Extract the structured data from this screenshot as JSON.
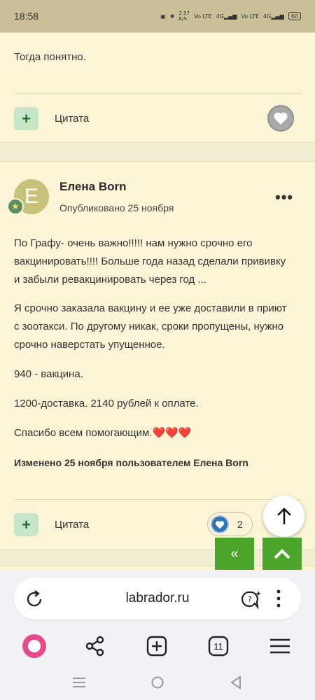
{
  "status": {
    "time": "18:58",
    "speed": "2,97",
    "speed_unit": "K/S",
    "sim1": "Vo LTE",
    "net1": "4G",
    "sim2": "Vo LTE",
    "net2": "4G",
    "battery": "60"
  },
  "post1": {
    "text": "Тогда понятно.",
    "quote_label": "Цитата"
  },
  "post2": {
    "avatar_letter": "E",
    "author": "Елена Born",
    "published": "Опубликовано 25 ноября",
    "paragraphs": [
      "По Графу-  очень важно!!!!! нам нужно срочно его вакцинировать!!!! Больше года назад сделали прививку и забыли ревакцинировать через год ...",
      "Я срочно заказала вакцину и ее уже доставили в приют с зоотакси. По другому никак, сроки пропущены, нужно срочно наверстать упущенное.",
      "940 - вакцина.",
      "1200-доставка. 2140 рублей к оплате.",
      "Спасибо всем  помогающим.❤️❤️❤️"
    ],
    "edited": "Изменено 25 ноября пользователем Елена Born",
    "quote_label": "Цитата",
    "like_count": "2"
  },
  "browser": {
    "url": "labrador.ru",
    "tab_count": "11"
  },
  "colors": {
    "accent_green": "#4aa52a",
    "like_blue": "#2e74b5",
    "alice_pink": "#e64a8a"
  }
}
